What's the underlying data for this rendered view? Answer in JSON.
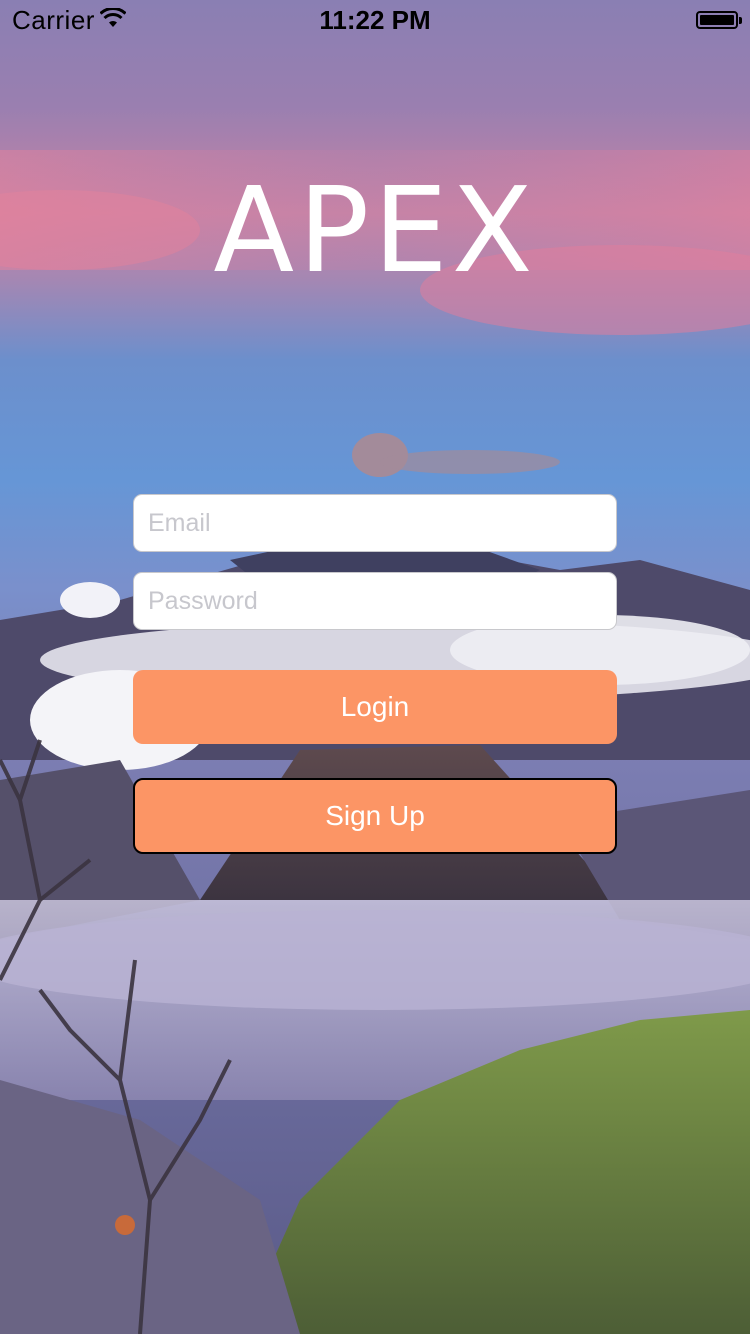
{
  "status_bar": {
    "carrier": "Carrier",
    "time": "11:22 PM"
  },
  "app": {
    "title": "APEX"
  },
  "form": {
    "email_placeholder": "Email",
    "password_placeholder": "Password",
    "login_label": "Login",
    "signup_label": "Sign Up"
  },
  "icons": {
    "wifi": "wifi-icon",
    "battery": "battery-icon"
  },
  "colors": {
    "button": "#fc9565",
    "button_text": "#ffffff",
    "title": "#ffffff",
    "field_bg": "#ffffff",
    "placeholder": "#c7c7cd"
  }
}
